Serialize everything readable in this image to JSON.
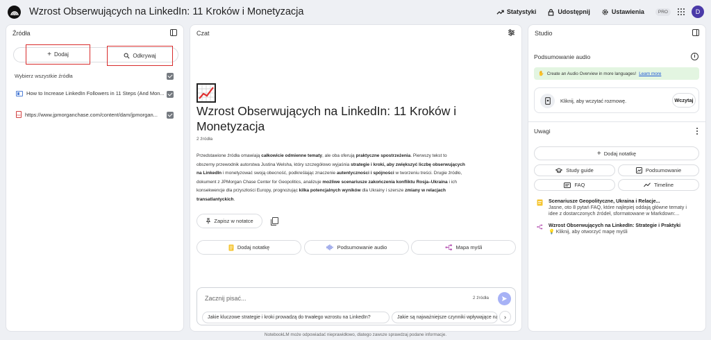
{
  "header": {
    "title": "Wzrost Obserwujących na LinkedIn: 11 Kroków i Monetyzacja",
    "actions": {
      "stats": "Statystyki",
      "share": "Udostępnij",
      "settings": "Ustawienia",
      "pro": "PRO"
    },
    "avatar_initial": "D"
  },
  "sources": {
    "title": "Źródła",
    "add_label": "Dodaj",
    "discover_label": "Odkrywaj",
    "select_all": "Wybierz wszystkie źródła",
    "items": [
      {
        "label": "How to Increase LinkedIn Followers in 11 Steps (And Mon...",
        "icon": "web-doc-icon",
        "checked": true
      },
      {
        "label": "https://www.jpmorganchase.com/content/dam/jpmorgan...",
        "icon": "pdf-icon",
        "checked": true
      }
    ]
  },
  "chat": {
    "title": "Czat",
    "notebook_title": "Wzrost Obserwujących na LinkedIn: 11 Kroków i Monetyzacja",
    "source_count": "2 źródła",
    "summary": [
      {
        "t": "Przedstawione źródła omawiają ",
        "b": false
      },
      {
        "t": "całkowicie odmienne tematy",
        "b": true
      },
      {
        "t": ", ale oba oferują ",
        "b": false
      },
      {
        "t": "praktyczne spostrzeżenia",
        "b": true
      },
      {
        "t": ". Pierwszy tekst to obszerny przewodnik autorstwa Justina Welsha, który szczegółowo wyjaśnia ",
        "b": false
      },
      {
        "t": "strategie i kroki, aby zwiększyć liczbę obserwujących na LinkedIn",
        "b": true
      },
      {
        "t": " i monetyzować swoją obecność, podkreślając znaczenie ",
        "b": false
      },
      {
        "t": "autentyczności i spójności",
        "b": true
      },
      {
        "t": " w tworzeniu treści. Drugie źródło, dokument z JPMorgan Chase Center for Geopolitics, analizuje ",
        "b": false
      },
      {
        "t": "możliwe scenariusze zakończenia konfliktu Rosja–Ukraina",
        "b": true
      },
      {
        "t": " i ich konsekwencje dla przyszłości Europy, prognozując ",
        "b": false
      },
      {
        "t": "kilka potencjalnych wyników",
        "b": true
      },
      {
        "t": " dla Ukrainy i szersze ",
        "b": false
      },
      {
        "t": "zmiany w relacjach transatlantyckich",
        "b": true
      },
      {
        "t": ".",
        "b": false
      }
    ],
    "save_note": "Zapisz w notatce",
    "actions": {
      "add_note": "Dodaj notatkę",
      "audio_summary": "Podsumowanie audio",
      "mind_map": "Mapa myśli"
    },
    "input": {
      "placeholder": "Zacznij pisać...",
      "source_count": "2 źródła"
    },
    "suggestions": [
      "Jakie kluczowe strategie i kroki prowadzą do trwałego wzrostu na LinkedIn?",
      "Jakie są najważniejsze czynniki wpływające na rozwój"
    ]
  },
  "studio": {
    "title": "Studio",
    "audio_title": "Podsumowanie audio",
    "banner_text": "Create an Audio Overview in more languages!",
    "banner_link": "Learn more",
    "audio_prompt": "Kliknij, aby wczytać rozmowę.",
    "load_label": "Wczytaj",
    "notes_title": "Uwagi",
    "add_note": "Dodaj notatkę",
    "buttons": {
      "study_guide": "Study guide",
      "summary": "Podsumowanie",
      "faq": "FAQ",
      "timeline": "Timeline"
    },
    "notes": [
      {
        "title": "Scenariusze Geopolityczne, Ukraina i Relacje...",
        "lines": [
          "Jasne, oto 8 pytań FAQ, które najlepiej oddają główne tematy i",
          "idee z dostarczonych źródeł, sformatowane w Markdown:..."
        ]
      },
      {
        "title": "Wzrost Obserwujących na LinkedIn: Strategie i Praktyki",
        "lines": [
          "Kliknij, aby otworzyć mapę myśli"
        ]
      }
    ]
  },
  "footer": "NotebookLM może odpowiadać nieprawidłowo, dlatego zawsze sprawdzaj podane informacje.",
  "colors": {
    "accent": "#4a3aa8",
    "highlight_border": "#d82a2a",
    "send_button": "#a7b2f6",
    "banner_bg": "#e3f5e1"
  }
}
